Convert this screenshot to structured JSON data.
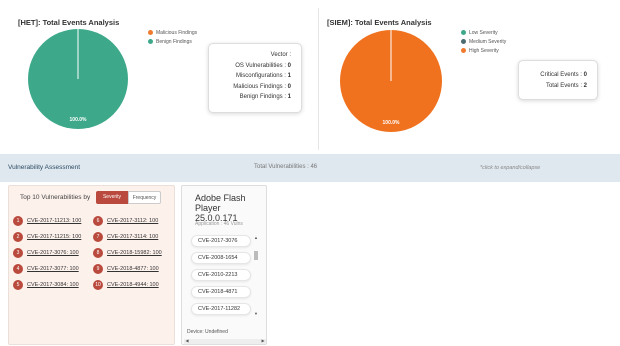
{
  "het": {
    "title": "[HET]: Total Events Analysis",
    "legend": [
      {
        "label": "Malicious Findings",
        "color": "#f07b2f"
      },
      {
        "label": "Benign Findings",
        "color": "#3ea98a"
      }
    ],
    "pie_label": "100.0%",
    "pie_color": "#3ea98a",
    "vector_title": "Vector :",
    "rows": [
      {
        "label": "OS Vulnerabilities : ",
        "value": "0"
      },
      {
        "label": "Misconfigurations : ",
        "value": "1"
      },
      {
        "label": "Malicious Findings : ",
        "value": "0"
      },
      {
        "label": "Benign Findings : ",
        "value": "1"
      }
    ]
  },
  "siem": {
    "title": "[SIEM]: Total Events Analysis",
    "legend": [
      {
        "label": "Low Severity",
        "color": "#3ea98a"
      },
      {
        "label": "Medium Severity",
        "color": "#4a6b72"
      },
      {
        "label": "High Severity",
        "color": "#f07b2f"
      }
    ],
    "pie_label": "100.0%",
    "pie_color": "#f0721f",
    "rows": [
      {
        "label": "Critical Events : ",
        "value": "0"
      },
      {
        "label": "Total Events : ",
        "value": "2"
      }
    ]
  },
  "va": {
    "title": "Vulnerability Assessment",
    "total": "Total Vulnerabilities : 46",
    "expand": "*click to expand/collapse"
  },
  "top10": {
    "title": "Top 10 Vulnerabilities by",
    "toggle_severity": "Severity",
    "toggle_frequency": "Frequency",
    "items": [
      {
        "num": "1",
        "text": "CVE-2017-11213: 100"
      },
      {
        "num": "2",
        "text": "CVE-2017-11215: 100"
      },
      {
        "num": "3",
        "text": "CVE-2017-3076: 100"
      },
      {
        "num": "4",
        "text": "CVE-2017-3077: 100"
      },
      {
        "num": "5",
        "text": "CVE-2017-3084: 100"
      },
      {
        "num": "6",
        "text": "CVE-2017-3112: 100"
      },
      {
        "num": "7",
        "text": "CVE-2017-3114: 100"
      },
      {
        "num": "8",
        "text": "CVE-2018-15982: 100"
      },
      {
        "num": "9",
        "text": "CVE-2018-4877: 100"
      },
      {
        "num": "10",
        "text": "CVE-2018-4944: 100"
      }
    ]
  },
  "detail": {
    "title": "Adobe Flash Player 25.0.0.171",
    "subtitle": "Application : 46 Vulns",
    "cves": [
      "CVE-2017-3076",
      "CVE-2008-1654",
      "CVE-2010-2213",
      "CVE-2018-4871",
      "CVE-2017-11282"
    ],
    "device": "Device: Undefined"
  }
}
